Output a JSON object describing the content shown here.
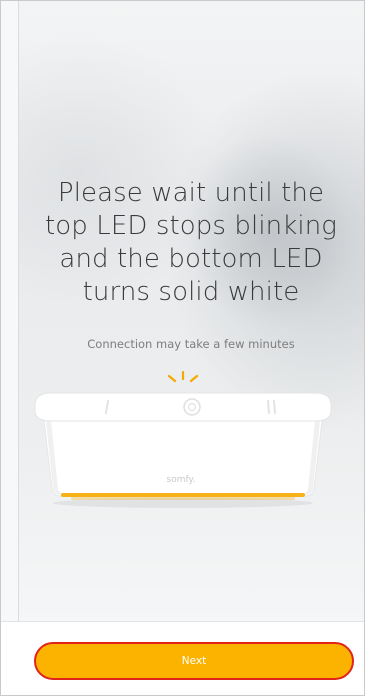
{
  "instruction": {
    "title_lines": [
      "Please wait until the",
      "top LED stops blinking",
      "and the bottom LED",
      "turns solid white"
    ],
    "subtitle": "Connection may take a few minutes"
  },
  "device": {
    "brand_text": "somfy.",
    "led_status": "top LED blinking",
    "led_color": "#f5a800",
    "bottom_led_color": "#f7b21a"
  },
  "footer": {
    "next_label": "Next",
    "button_color": "#fbb300",
    "highlight_border_color": "#e2231a"
  }
}
